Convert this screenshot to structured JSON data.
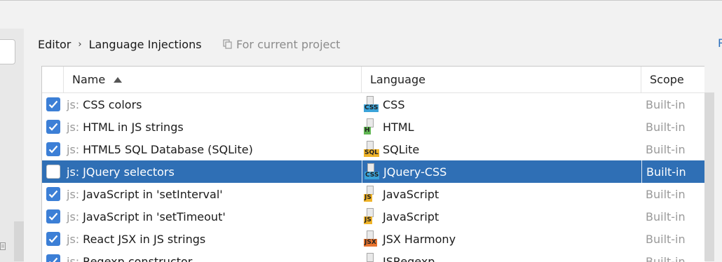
{
  "breadcrumb": {
    "parent": "Editor",
    "separator": "›",
    "current": "Language Injections"
  },
  "scope_hint": {
    "icon": "copy-icon",
    "label": "For current project"
  },
  "right_link": "R",
  "table": {
    "columns": {
      "name": "Name",
      "language": "Language",
      "scope": "Scope"
    },
    "sort": {
      "column": "Name",
      "direction": "ascending"
    },
    "rows": [
      {
        "checked": true,
        "prefix": "js:",
        "name": "CSS colors",
        "lang_icon": "css-file-icon",
        "lang_tag": "CSS",
        "lang_color": "#3aa3d9",
        "language": "CSS",
        "scope": "Built-in",
        "selected": false
      },
      {
        "checked": true,
        "prefix": "js:",
        "name": "HTML in JS strings",
        "lang_icon": "html-file-icon",
        "lang_tag": "H",
        "lang_color": "#5fb552",
        "language": "HTML",
        "scope": "Built-in",
        "selected": false
      },
      {
        "checked": true,
        "prefix": "js:",
        "name": "HTML5 SQL Database (SQLite)",
        "lang_icon": "sql-file-icon",
        "lang_tag": "SQL",
        "lang_color": "#f0b429",
        "language": "SQLite",
        "scope": "Built-in",
        "selected": false
      },
      {
        "checked": false,
        "prefix": "js:",
        "name": "JQuery selectors",
        "lang_icon": "css-file-icon",
        "lang_tag": "CSS",
        "lang_color": "#3aa3d9",
        "language": "JQuery-CSS",
        "scope": "Built-in",
        "selected": true
      },
      {
        "checked": true,
        "prefix": "js:",
        "name": "JavaScript in 'setInterval'",
        "lang_icon": "js-file-icon",
        "lang_tag": "JS",
        "lang_color": "#f0b429",
        "language": "JavaScript",
        "scope": "Built-in",
        "selected": false
      },
      {
        "checked": true,
        "prefix": "js:",
        "name": "JavaScript in 'setTimeout'",
        "lang_icon": "js-file-icon",
        "lang_tag": "JS",
        "lang_color": "#f0b429",
        "language": "JavaScript",
        "scope": "Built-in",
        "selected": false
      },
      {
        "checked": true,
        "prefix": "js:",
        "name": "React JSX in JS strings",
        "lang_icon": "jsx-file-icon",
        "lang_tag": "JSX",
        "lang_color": "#e8742f",
        "language": "JSX Harmony",
        "scope": "Built-in",
        "selected": false
      },
      {
        "checked": true,
        "prefix": "js:",
        "name": "Regexp constructor",
        "lang_icon": "regexp-file-icon",
        "lang_tag": "",
        "lang_color": "#9a9a9a",
        "language": "JSRegexp",
        "scope": "Built-in",
        "selected": false
      }
    ]
  },
  "colors": {
    "selection": "#2f6fb5",
    "checkbox": "#3c7fd6",
    "link": "#2a6ebb"
  }
}
